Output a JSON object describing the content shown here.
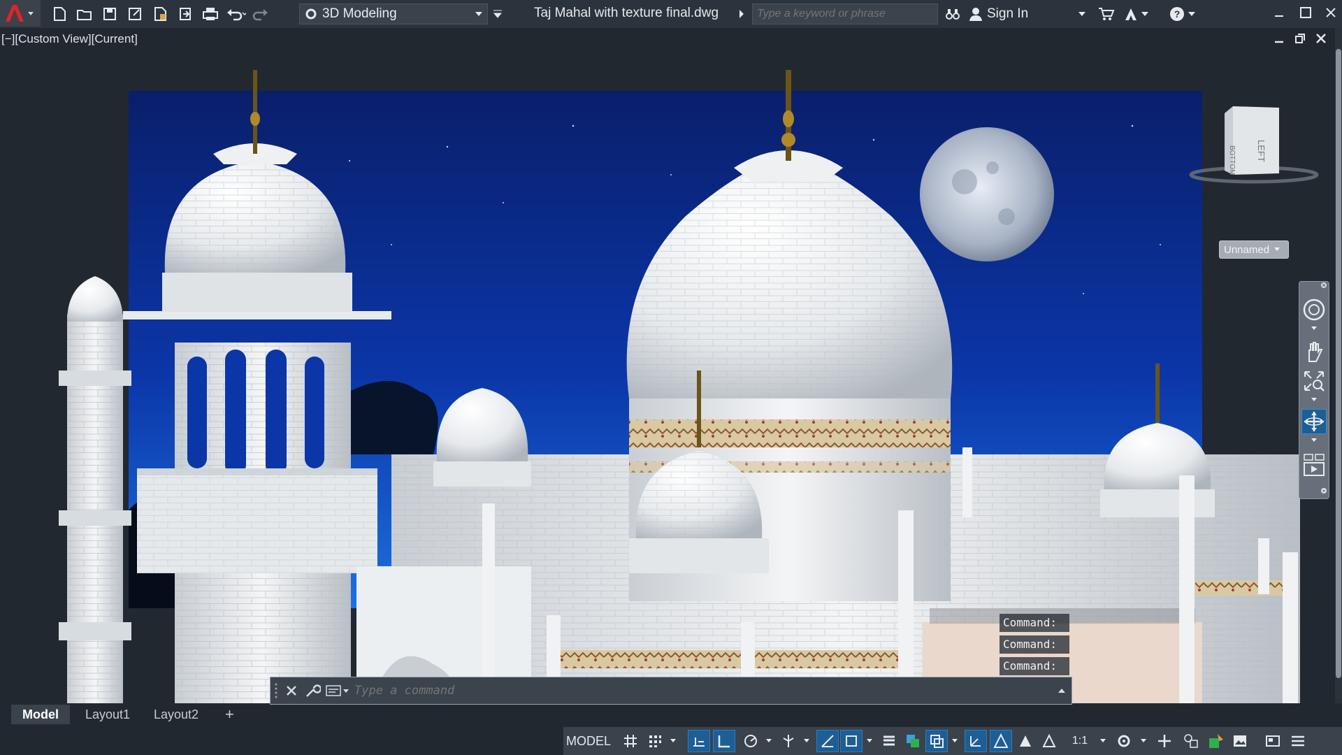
{
  "titlebar": {
    "workspace": "3D Modeling",
    "document_title": "Taj Mahal with texture final.dwg",
    "search_placeholder": "Type a keyword or phrase",
    "sign_in": "Sign In"
  },
  "viewport": {
    "label": "[−][Custom View][Current]",
    "view_name": "Unnamed",
    "viewcube_faces": [
      "BOTTOM",
      "LEFT"
    ]
  },
  "command": {
    "history": [
      "Command:",
      "Command:",
      "Command:"
    ],
    "placeholder": "Type a command"
  },
  "layout_tabs": [
    "Model",
    "Layout1",
    "Layout2"
  ],
  "status": {
    "model_label": "MODEL",
    "annotation_scale": "1:1"
  },
  "colors": {
    "titlebar_bg": "#2b333c",
    "canvas_bg": "#212830",
    "accent": "#1d5e95",
    "sky": "#0a2e8a"
  }
}
